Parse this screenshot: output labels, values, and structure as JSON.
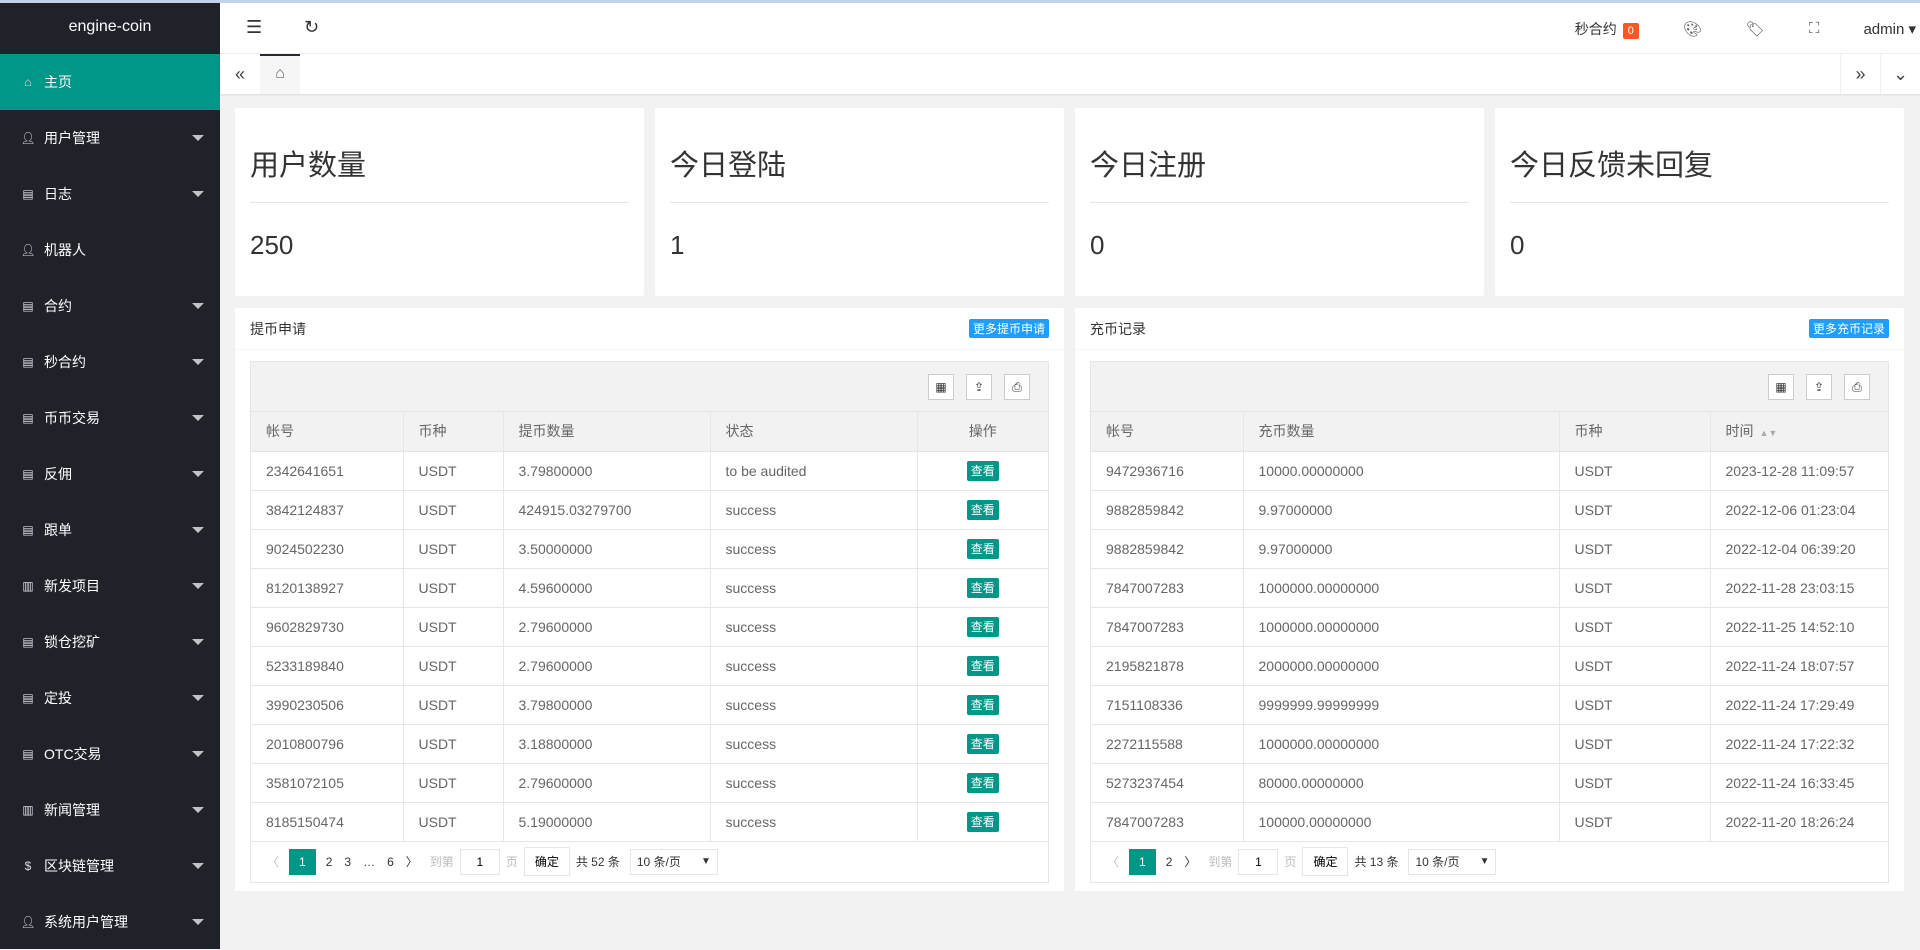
{
  "app": {
    "logo": "engine-coin"
  },
  "sidebar": {
    "items": [
      {
        "label": "主页",
        "icon": "home-icon",
        "active": true
      },
      {
        "label": "用户管理",
        "icon": "user-icon"
      },
      {
        "label": "日志",
        "icon": "file-icon"
      },
      {
        "label": "机器人",
        "icon": "user-icon"
      },
      {
        "label": "合约",
        "icon": "file-icon"
      },
      {
        "label": "秒合约",
        "icon": "file-icon"
      },
      {
        "label": "币币交易",
        "icon": "file-icon"
      },
      {
        "label": "反佣",
        "icon": "file-icon"
      },
      {
        "label": "跟单",
        "icon": "file-icon"
      },
      {
        "label": "新发项目",
        "icon": "list-icon"
      },
      {
        "label": "锁仓挖矿",
        "icon": "file-icon"
      },
      {
        "label": "定投",
        "icon": "file-icon"
      },
      {
        "label": "OTC交易",
        "icon": "file-icon"
      },
      {
        "label": "新闻管理",
        "icon": "list-icon"
      },
      {
        "label": "区块链管理",
        "icon": "dollar-icon"
      },
      {
        "label": "系统用户管理",
        "icon": "user-icon"
      }
    ]
  },
  "header": {
    "second_contract": "秒合约",
    "second_contract_count": "0",
    "user": "admin"
  },
  "stats": [
    {
      "title": "用户数量",
      "value": "250"
    },
    {
      "title": "今日登陆",
      "value": "1"
    },
    {
      "title": "今日注册",
      "value": "0"
    },
    {
      "title": "今日反馈未回复",
      "value": "0"
    }
  ],
  "withdraw": {
    "title": "提币申请",
    "more": "更多提币申请",
    "columns": [
      "帐号",
      "币种",
      "提币数量",
      "状态",
      "操作"
    ],
    "action": "查看",
    "rows": [
      [
        "2342641651",
        "USDT",
        "3.79800000",
        "to be audited"
      ],
      [
        "3842124837",
        "USDT",
        "424915.03279700",
        "success"
      ],
      [
        "9024502230",
        "USDT",
        "3.50000000",
        "success"
      ],
      [
        "8120138927",
        "USDT",
        "4.59600000",
        "success"
      ],
      [
        "9602829730",
        "USDT",
        "2.79600000",
        "success"
      ],
      [
        "5233189840",
        "USDT",
        "2.79600000",
        "success"
      ],
      [
        "3990230506",
        "USDT",
        "3.79800000",
        "success"
      ],
      [
        "2010800796",
        "USDT",
        "3.18800000",
        "success"
      ],
      [
        "3581072105",
        "USDT",
        "2.79600000",
        "success"
      ],
      [
        "8185150474",
        "USDT",
        "5.19000000",
        "success"
      ]
    ],
    "pager": {
      "pages": [
        "1",
        "2",
        "3",
        "…",
        "6"
      ],
      "goto": "到第",
      "page_input": "1",
      "page_unit": "页",
      "confirm": "确定",
      "total": "共 52 条",
      "per_page": "10 条/页"
    }
  },
  "recharge": {
    "title": "充币记录",
    "more": "更多充币记录",
    "columns": [
      "帐号",
      "充币数量",
      "币种",
      "时间"
    ],
    "rows": [
      [
        "9472936716",
        "10000.00000000",
        "USDT",
        "2023-12-28 11:09:57"
      ],
      [
        "9882859842",
        "9.97000000",
        "USDT",
        "2022-12-06 01:23:04"
      ],
      [
        "9882859842",
        "9.97000000",
        "USDT",
        "2022-12-04 06:39:20"
      ],
      [
        "7847007283",
        "1000000.00000000",
        "USDT",
        "2022-11-28 23:03:15"
      ],
      [
        "7847007283",
        "1000000.00000000",
        "USDT",
        "2022-11-25 14:52:10"
      ],
      [
        "2195821878",
        "2000000.00000000",
        "USDT",
        "2022-11-24 18:07:57"
      ],
      [
        "7151108336",
        "9999999.99999999",
        "USDT",
        "2022-11-24 17:29:49"
      ],
      [
        "2272115588",
        "1000000.00000000",
        "USDT",
        "2022-11-24 17:22:32"
      ],
      [
        "5273237454",
        "80000.00000000",
        "USDT",
        "2022-11-24 16:33:45"
      ],
      [
        "7847007283",
        "100000.00000000",
        "USDT",
        "2022-11-20 18:26:24"
      ]
    ],
    "pager": {
      "pages": [
        "1",
        "2"
      ],
      "goto": "到第",
      "page_input": "1",
      "page_unit": "页",
      "confirm": "确定",
      "total": "共 13 条",
      "per_page": "10 条/页"
    }
  }
}
